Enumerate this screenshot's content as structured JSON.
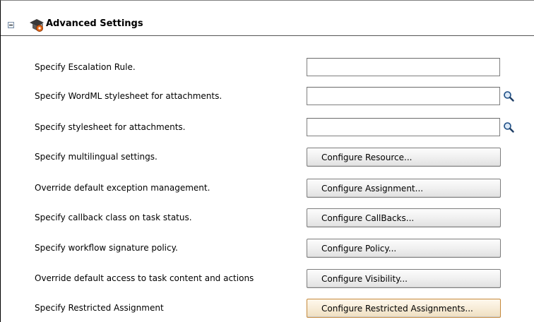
{
  "header": {
    "title": "Advanced Settings",
    "collapse_icon": "minus-icon",
    "section_icon": "settings-cap-icon"
  },
  "rows": [
    {
      "label": "Specify Escalation Rule.",
      "control": "text",
      "value": ""
    },
    {
      "label": "Specify WordML stylesheet for attachments.",
      "control": "text-search",
      "value": ""
    },
    {
      "label": "Specify stylesheet for attachments.",
      "control": "text-search",
      "value": ""
    },
    {
      "label": "Specify multilingual settings.",
      "control": "button",
      "button_label": "Configure Resource..."
    },
    {
      "label": "Override default exception management.",
      "control": "button",
      "button_label": "Configure Assignment..."
    },
    {
      "label": "Specify callback class on task status.",
      "control": "button",
      "button_label": "Configure CallBacks..."
    },
    {
      "label": "Specify workflow signature policy.",
      "control": "button",
      "button_label": "Configure Policy..."
    },
    {
      "label": "Override default access to task content and actions",
      "control": "button",
      "button_label": "Configure Visibility..."
    },
    {
      "label": "Specify Restricted Assignment",
      "control": "button",
      "button_label": "Configure Restricted Assignments...",
      "focused": true
    }
  ],
  "colors": {
    "focus_border": "#c5893b",
    "border": "#7d7d7d"
  }
}
